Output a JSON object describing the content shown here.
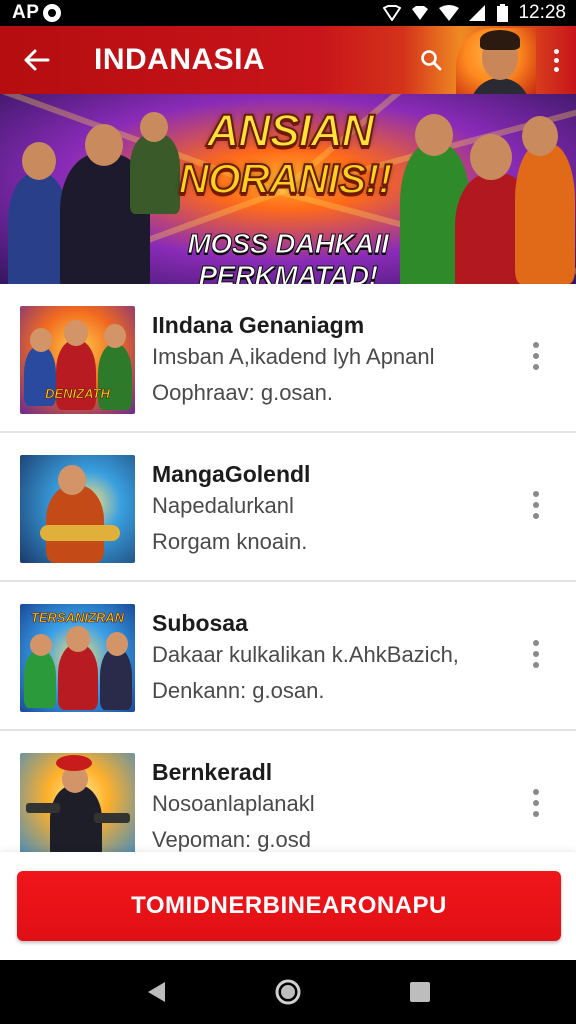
{
  "status_bar": {
    "left_text": "AP",
    "time": "12:28",
    "icons": [
      "notification-icon",
      "vpn-icon",
      "data-icon",
      "wifi-icon",
      "signal-icon",
      "battery-icon"
    ]
  },
  "app_bar": {
    "title": "INDANASIA",
    "icons": [
      "back-arrow-icon",
      "search-icon",
      "more-vert-icon"
    ],
    "colors": {
      "primary": "#c8141a",
      "accent": "#f08a22"
    }
  },
  "banner": {
    "title_line1": "ANSIAN",
    "title_line2": "NORANIS!!",
    "subtitle": "MOSS DAHKAII PERKMATAD!"
  },
  "list": {
    "items": [
      {
        "title": "IIndana Genaniagm",
        "line1": "Imsban A,ikadend lyh Apnanl",
        "line2": "Oophraav: g.osan.",
        "thumb_caption": "DENIZATH"
      },
      {
        "title": "MangaGolendl",
        "line1": "Napedalurkanl",
        "line2": "Rorgam knoain.",
        "thumb_caption": ""
      },
      {
        "title": "Subosaa",
        "line1": "Dakaar kulkalikan k.AhkBazich,",
        "line2": "Denkann: g.osan.",
        "thumb_caption": "TERSANIZRAN"
      },
      {
        "title": "Bernkeradl",
        "line1": "Nosoanlaplanakl",
        "line2": "Vepoman: g.osd",
        "thumb_caption": ""
      }
    ]
  },
  "cta": {
    "label": "TOMIDNERBINEARONAPU",
    "color": "#e8121a"
  },
  "nav_bar": {
    "icons": [
      "nav-back-icon",
      "nav-home-icon",
      "nav-recents-icon"
    ]
  }
}
